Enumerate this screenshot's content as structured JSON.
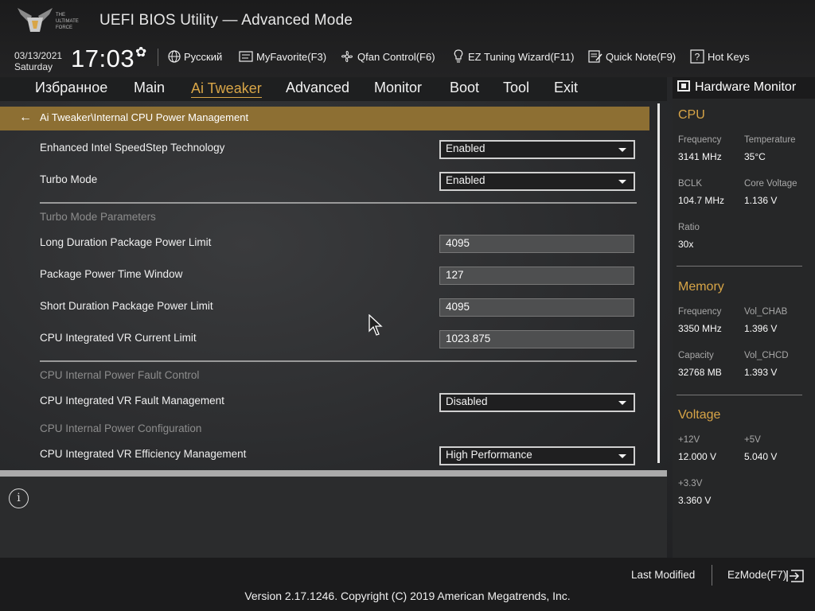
{
  "header": {
    "title": "UEFI BIOS Utility — Advanced Mode",
    "brand_logo_text": "THE ULTIMATE FORCE",
    "date": "03/13/2021",
    "day": "Saturday",
    "time": "17:03",
    "toolbar": [
      {
        "label": "Русский",
        "icon": "globe-icon"
      },
      {
        "label": "MyFavorite(F3)",
        "icon": "favorite-icon"
      },
      {
        "label": "Qfan Control(F6)",
        "icon": "fan-icon"
      },
      {
        "label": "EZ Tuning Wizard(F11)",
        "icon": "bulb-icon"
      },
      {
        "label": "Quick Note(F9)",
        "icon": "note-icon"
      },
      {
        "label": "Hot Keys",
        "icon": "question-icon"
      }
    ]
  },
  "menu": {
    "items": [
      "Избранное",
      "Main",
      "Ai Tweaker",
      "Advanced",
      "Monitor",
      "Boot",
      "Tool",
      "Exit"
    ],
    "active": "Ai Tweaker"
  },
  "breadcrumb": "Ai Tweaker\\Internal CPU Power Management",
  "settings": {
    "speedstep": {
      "label": "Enhanced Intel SpeedStep Technology",
      "value": "Enabled"
    },
    "turbo": {
      "label": "Turbo Mode",
      "value": "Enabled"
    },
    "section_turbo_params": "Turbo Mode Parameters",
    "long_duration": {
      "label": "Long Duration Package Power Limit",
      "value": "4095"
    },
    "time_window": {
      "label": "Package Power Time Window",
      "value": "127"
    },
    "short_duration": {
      "label": "Short Duration Package Power Limit",
      "value": "4095"
    },
    "vr_current": {
      "label": "CPU Integrated VR Current Limit",
      "value": "1023.875"
    },
    "section_fault": "CPU Internal Power Fault Control",
    "vr_fault": {
      "label": "CPU Integrated VR Fault Management",
      "value": "Disabled"
    },
    "section_config": "CPU Internal Power Configuration",
    "vr_efficiency": {
      "label": "CPU Integrated VR Efficiency Management",
      "value": "High Performance"
    }
  },
  "hardware_monitor": {
    "title": "Hardware Monitor",
    "cpu": {
      "heading": "CPU",
      "frequency_label": "Frequency",
      "frequency": "3141 MHz",
      "temperature_label": "Temperature",
      "temperature": "35°C",
      "bclk_label": "BCLK",
      "bclk": "104.7 MHz",
      "core_voltage_label": "Core Voltage",
      "core_voltage": "1.136 V",
      "ratio_label": "Ratio",
      "ratio": "30x"
    },
    "memory": {
      "heading": "Memory",
      "frequency_label": "Frequency",
      "frequency": "3350 MHz",
      "vol_chab_label": "Vol_CHAB",
      "vol_chab": "1.396 V",
      "capacity_label": "Capacity",
      "capacity": "32768 MB",
      "vol_chcd_label": "Vol_CHCD",
      "vol_chcd": "1.393 V"
    },
    "voltage": {
      "heading": "Voltage",
      "v12_label": "+12V",
      "v12": "12.000 V",
      "v5_label": "+5V",
      "v5": "5.040 V",
      "v33_label": "+3.3V",
      "v33": "3.360 V"
    }
  },
  "footer": {
    "last_modified": "Last Modified",
    "ezmode": "EzMode(F7)",
    "copyright": "Version 2.17.1246. Copyright (C) 2019 American Megatrends, Inc."
  },
  "colors": {
    "accent": "#d8a547",
    "breadcrumb_bar": "#8d6f33"
  }
}
